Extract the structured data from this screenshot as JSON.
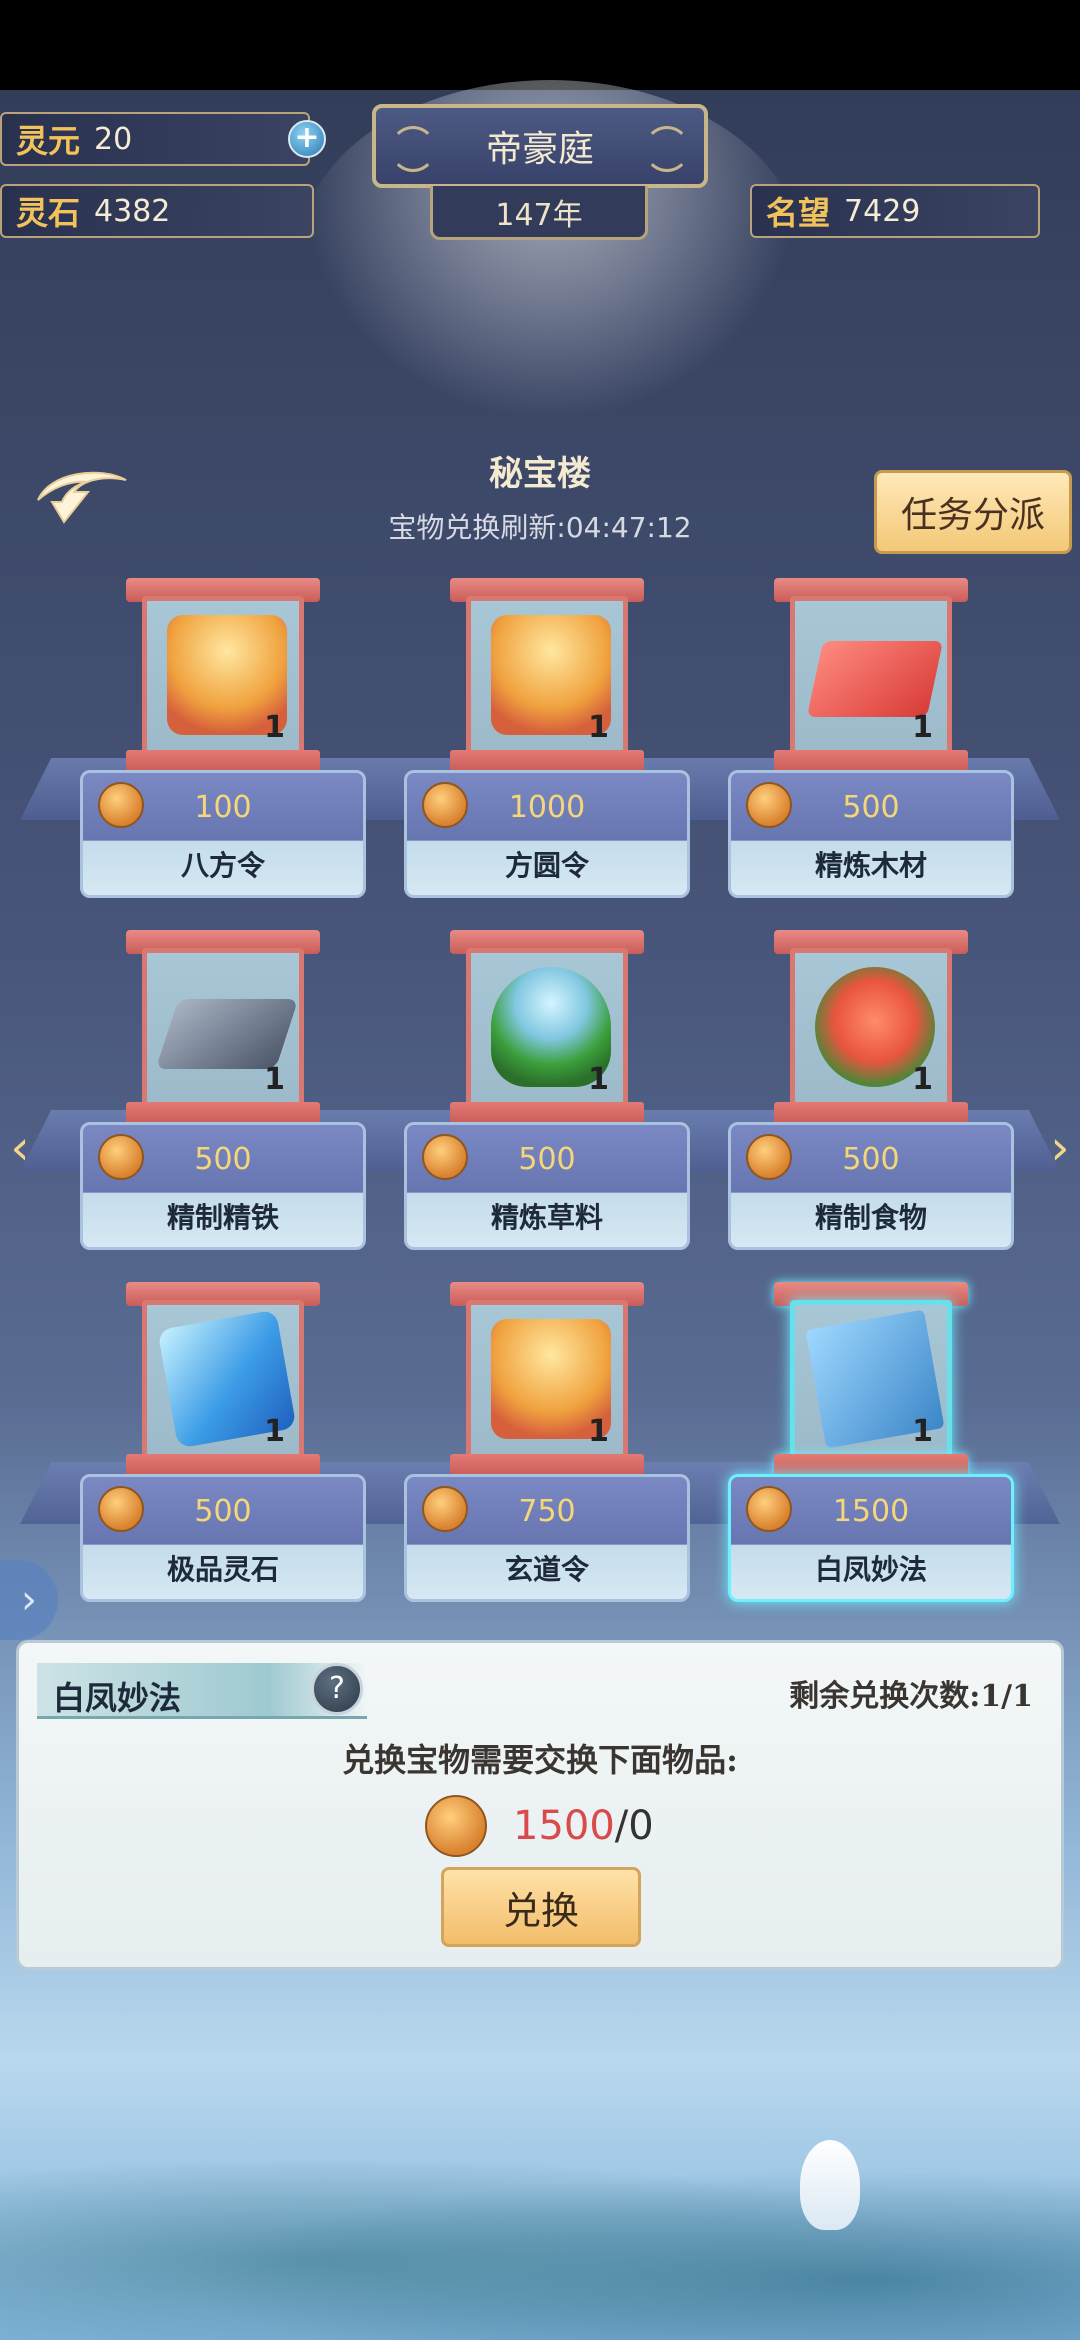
{
  "resources": {
    "lingyuan_label": "灵元",
    "lingyuan_value": "20",
    "lingshi_label": "灵石",
    "lingshi_value": "4382",
    "mingwang_label": "名望",
    "mingwang_value": "7429"
  },
  "header": {
    "title": "帝豪庭",
    "year": "147年"
  },
  "pavilion": {
    "title": "秘宝楼",
    "refresh_text": "宝物兑换刷新:04:47:12"
  },
  "task_button": "任务分派",
  "items": [
    {
      "name": "八方令",
      "price": "100",
      "count": "1",
      "icon": "token-icon"
    },
    {
      "name": "方圆令",
      "price": "1000",
      "count": "1",
      "icon": "token-icon"
    },
    {
      "name": "精炼木材",
      "price": "500",
      "count": "1",
      "icon": "wood-icon"
    },
    {
      "name": "精制精铁",
      "price": "500",
      "count": "1",
      "icon": "iron-icon"
    },
    {
      "name": "精炼草料",
      "price": "500",
      "count": "1",
      "icon": "herb-icon"
    },
    {
      "name": "精制食物",
      "price": "500",
      "count": "1",
      "icon": "meat-icon"
    },
    {
      "name": "极品灵石",
      "price": "500",
      "count": "1",
      "icon": "spirit-stone-icon"
    },
    {
      "name": "玄道令",
      "price": "750",
      "count": "1",
      "icon": "token-icon"
    },
    {
      "name": "白凤妙法",
      "price": "1500",
      "count": "1",
      "icon": "book-icon",
      "selected": true
    }
  ],
  "detail": {
    "title": "白凤妙法",
    "help": "?",
    "remaining": "剩余兑换次数:1/1",
    "requirement": "兑换宝物需要交换下面物品:",
    "cost_need": "1500",
    "cost_have": "/0",
    "exchange_label": "兑换"
  },
  "colors": {
    "accent_gold": "#f2c35a",
    "selected_glow": "#6ff0ff",
    "cost_red": "#d94a4a"
  }
}
